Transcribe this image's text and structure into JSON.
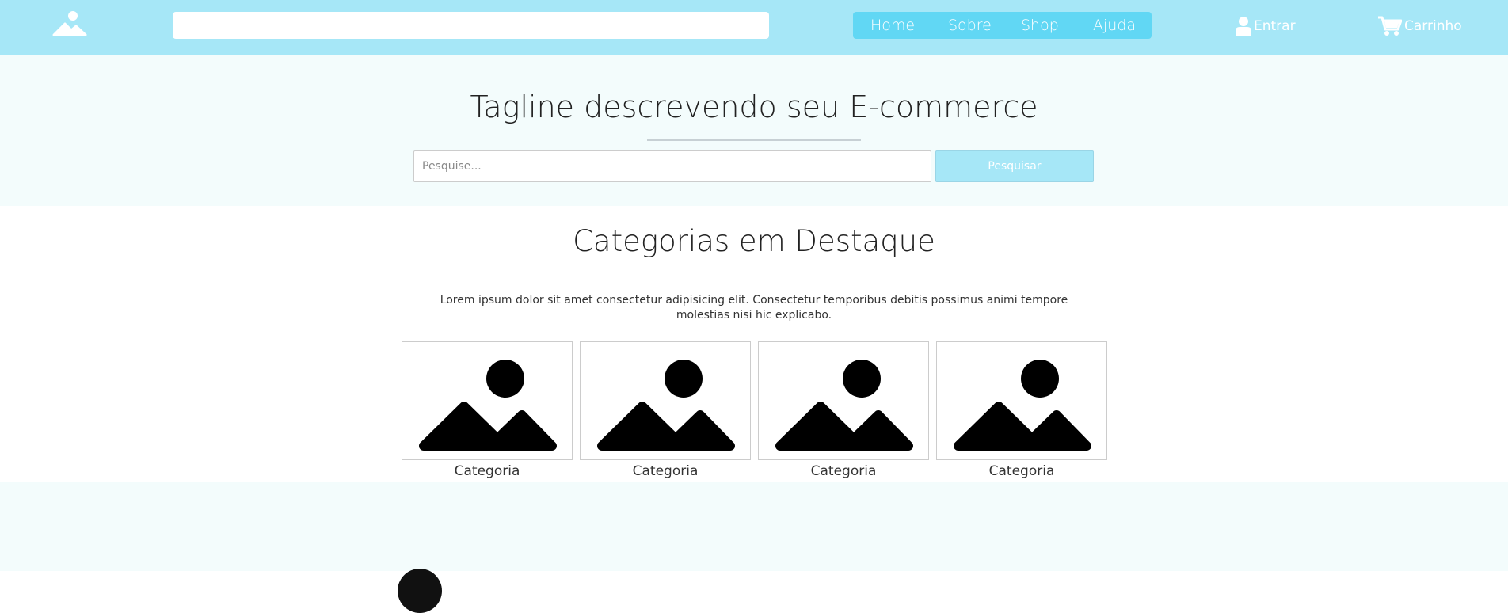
{
  "header": {
    "logo_icon": "image-icon",
    "search_value": "",
    "nav": [
      "Home",
      "Sobre",
      "Shop",
      "Ajuda"
    ],
    "login_label": "Entrar",
    "login_icon": "user-icon",
    "cart_label": "Carrinho",
    "cart_icon": "cart-icon"
  },
  "hero": {
    "tagline": "Tagline descrevendo seu E-commerce",
    "search_placeholder": "Pesquise...",
    "search_button": "Pesquisar"
  },
  "categories": {
    "title": "Categorias em Destaque",
    "description": "Lorem ipsum dolor sit amet consectetur adipisicing elit. Consectetur temporibus debitis possimus animi tempore molestias nisi hic explicabo.",
    "items": [
      {
        "label": "Categoria",
        "icon": "image-placeholder-icon"
      },
      {
        "label": "Categoria",
        "icon": "image-placeholder-icon"
      },
      {
        "label": "Categoria",
        "icon": "image-placeholder-icon"
      },
      {
        "label": "Categoria",
        "icon": "image-placeholder-icon"
      }
    ]
  },
  "colors": {
    "header_bg": "#a6e7f7",
    "nav_bg": "#61d7f4",
    "hero_bg": "#f3fcfc",
    "button_bg": "#a6e7f7"
  }
}
